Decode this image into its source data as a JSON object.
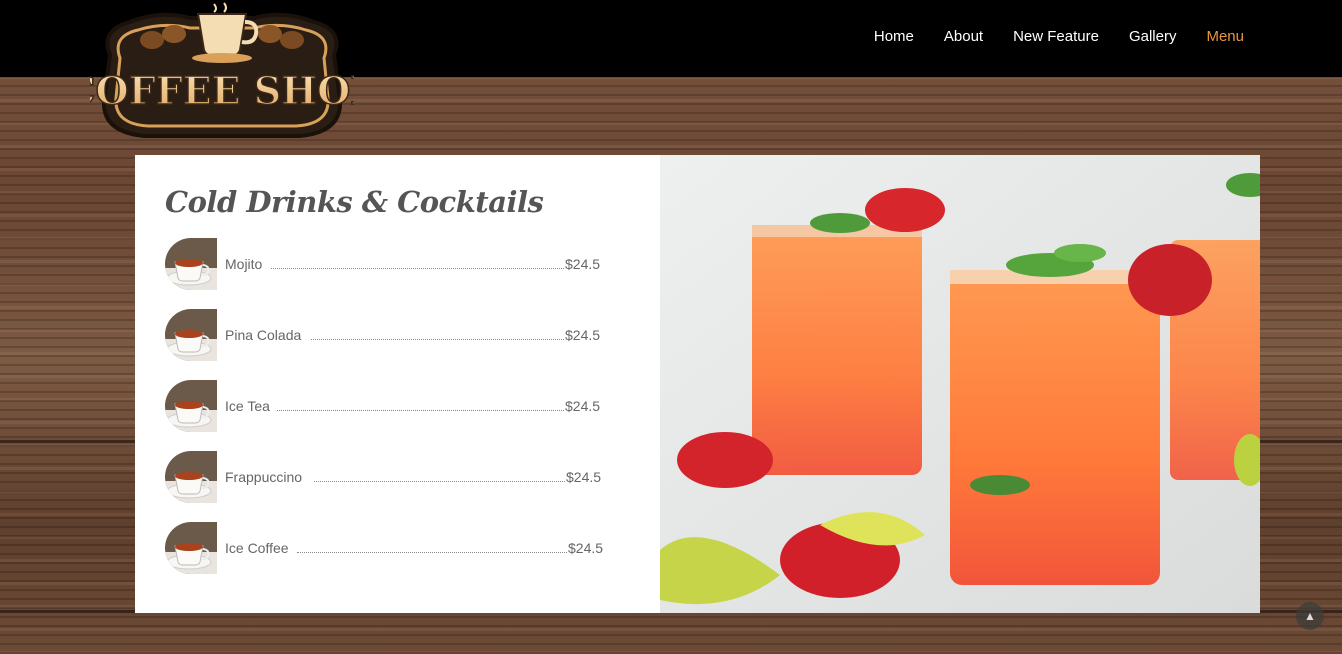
{
  "brand": {
    "logo_text": "COFFEE SHOP",
    "logo_icon": "coffee-cup-icon"
  },
  "nav": {
    "items": [
      {
        "label": "Home"
      },
      {
        "label": "About"
      },
      {
        "label": "New Feature"
      },
      {
        "label": "Gallery"
      },
      {
        "label": "Menu"
      }
    ],
    "active": "Menu"
  },
  "menu": {
    "title": "Cold Drinks & Cocktails",
    "items": [
      {
        "name": "Mojito",
        "price": "$24.5"
      },
      {
        "name": "Pina Colada",
        "price": "$24.5"
      },
      {
        "name": "Ice Tea",
        "price": "$24.5"
      },
      {
        "name": "Frappuccino",
        "price": "$24.5"
      },
      {
        "name": "Ice Coffee",
        "price": "$24.5"
      }
    ]
  },
  "photo": {
    "alt_icon": "strawberry-drink-photo"
  },
  "scroll_top": {
    "icon": "chevron-up-icon"
  },
  "colors": {
    "nav_bg": "#000000",
    "nav_text": "#ffffff",
    "nav_active": "#e8963c",
    "title": "#555555",
    "item_text": "#666666"
  }
}
